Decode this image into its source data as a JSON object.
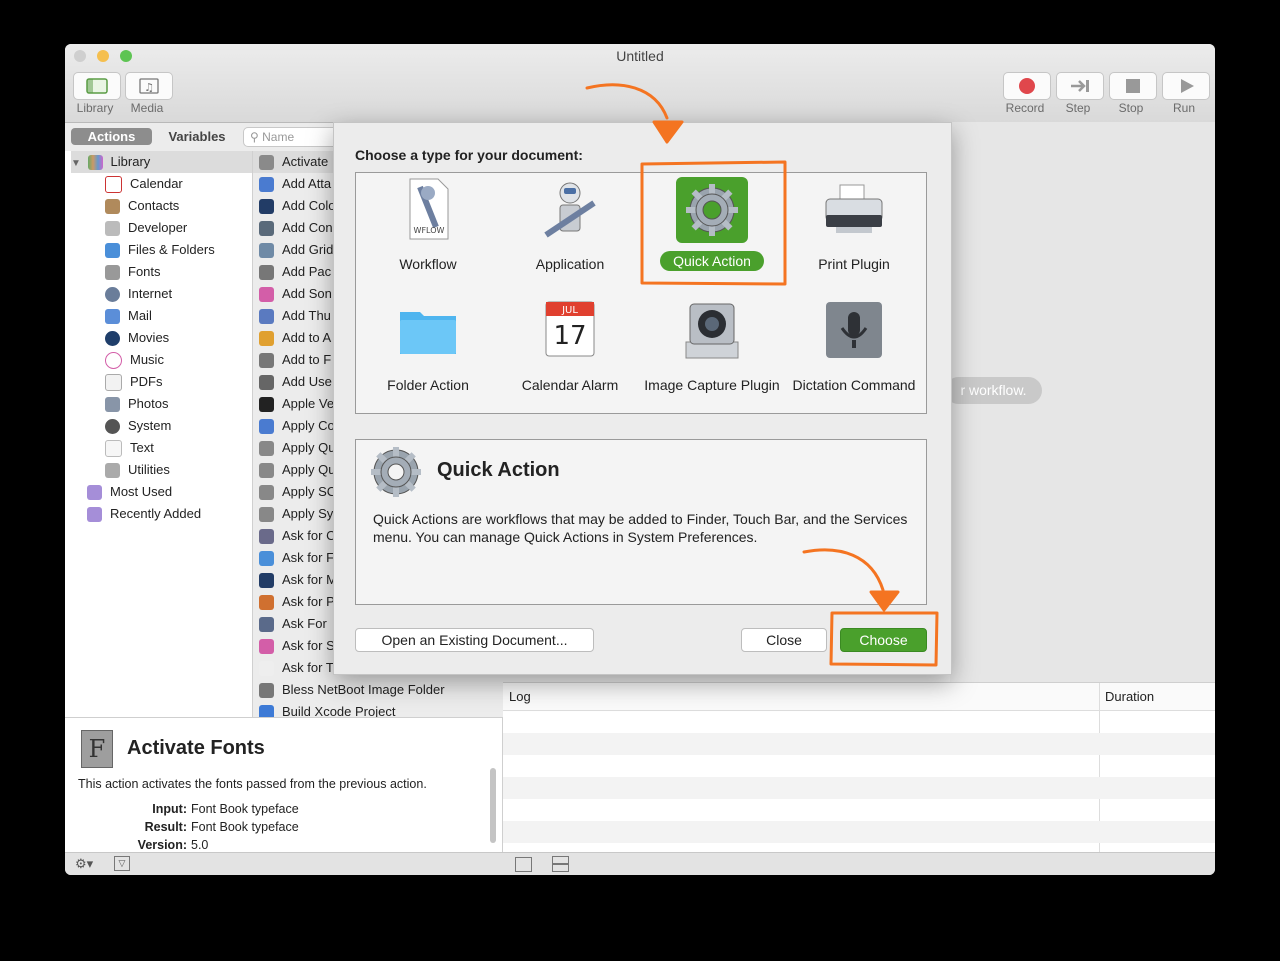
{
  "window": {
    "title": "Untitled"
  },
  "toolbar": {
    "library_label": "Library",
    "media_label": "Media",
    "record_label": "Record",
    "step_label": "Step",
    "stop_label": "Stop",
    "run_label": "Run"
  },
  "library_tabs": {
    "actions": "Actions",
    "variables": "Variables",
    "search_placeholder": "Name"
  },
  "library_tree": {
    "root": "Library",
    "items": [
      "Calendar",
      "Contacts",
      "Developer",
      "Files & Folders",
      "Fonts",
      "Internet",
      "Mail",
      "Movies",
      "Music",
      "PDFs",
      "Photos",
      "System",
      "Text",
      "Utilities"
    ],
    "extras": [
      "Most Used",
      "Recently Added"
    ]
  },
  "actions_list": [
    "Activate",
    "Add Atta",
    "Add Colo",
    "Add Con",
    "Add Grid",
    "Add Pac",
    "Add Son",
    "Add Thu",
    "Add to A",
    "Add to F",
    "Add Use",
    "Apple Ve",
    "Apply Co",
    "Apply Qu",
    "Apply Qu",
    "Apply SC",
    "Apply Sy",
    "Ask for C",
    "Ask for F",
    "Ask for M",
    "Ask for P",
    "Ask For",
    "Ask for S",
    "Ask for T",
    "Bless NetBoot Image Folder",
    "Build Xcode Project"
  ],
  "action_info": {
    "title": "Activate Fonts",
    "description": "This action activates the fonts passed from the previous action.",
    "input_label": "Input:",
    "input_value": "Font Book typeface",
    "result_label": "Result:",
    "result_value": "Font Book typeface",
    "version_label": "Version:",
    "version_value": "5.0"
  },
  "canvas": {
    "hint": "r workflow."
  },
  "log": {
    "log_header": "Log",
    "duration_header": "Duration"
  },
  "dialog": {
    "heading": "Choose a type for your document:",
    "types": [
      "Workflow",
      "Application",
      "Quick Action",
      "Print Plugin",
      "Folder Action",
      "Calendar Alarm",
      "Image Capture Plugin",
      "Dictation Command"
    ],
    "wflow_badge": "WFLOW",
    "calendar_month": "JUL",
    "calendar_day": "17",
    "selected": "Quick Action",
    "desc_title": "Quick Action",
    "desc_text": "Quick Actions are workflows that may be added to Finder, Touch Bar, and the Services menu. You can manage Quick Actions in System Preferences.",
    "open_existing": "Open an Existing Document...",
    "close": "Close",
    "choose": "Choose"
  },
  "colors": {
    "accent_green": "#4aa02c",
    "annotation_orange": "#f47421",
    "record_red": "#e0474c"
  }
}
